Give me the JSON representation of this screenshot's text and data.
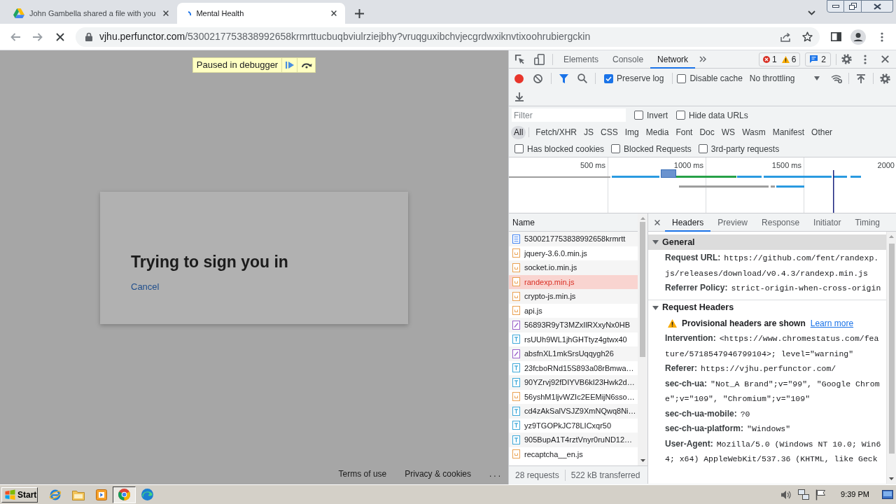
{
  "browser": {
    "tabs": [
      {
        "kind": "triangle",
        "title": "John Gambella shared a file with you",
        "selected": false
      },
      {
        "kind": "spinner",
        "title": "Mental Health",
        "selected": true
      }
    ],
    "address": {
      "host": "vjhu.perfunctor.com",
      "path": "/5300217753838992658krmrttucbuqbviulrziejbhy?vruqguxibchvjecgrdwxiknvtixoohrubiergckin"
    }
  },
  "page": {
    "debugger_banner": "Paused in debugger",
    "dialog": {
      "title": "Trying to sign you in",
      "cancel": "Cancel"
    },
    "footer_links": [
      "Terms of use",
      "Privacy & cookies",
      "..."
    ]
  },
  "devtools": {
    "tabs": [
      {
        "label": "Elements",
        "selected": false
      },
      {
        "label": "Console",
        "selected": false
      },
      {
        "label": "Network",
        "selected": true
      }
    ],
    "issues": {
      "errors": "1",
      "warnings": "6",
      "messages": "2"
    },
    "toolbar": {
      "checkboxes": [
        {
          "label": "Preserve log",
          "checked": true
        },
        {
          "label": "Disable cache",
          "checked": false
        }
      ],
      "throttling": "No throttling"
    },
    "filter": {
      "placeholder": "Filter",
      "options": [
        {
          "label": "Invert",
          "checked": false
        },
        {
          "label": "Hide data URLs",
          "checked": false
        }
      ]
    },
    "type_filters": [
      {
        "label": "All",
        "selected": true
      },
      {
        "label": "Fetch/XHR",
        "selected": false
      },
      {
        "label": "JS",
        "selected": false
      },
      {
        "label": "CSS",
        "selected": false
      },
      {
        "label": "Img",
        "selected": false
      },
      {
        "label": "Media",
        "selected": false
      },
      {
        "label": "Font",
        "selected": false
      },
      {
        "label": "Doc",
        "selected": false
      },
      {
        "label": "WS",
        "selected": false
      },
      {
        "label": "Wasm",
        "selected": false
      },
      {
        "label": "Manifest",
        "selected": false
      },
      {
        "label": "Other",
        "selected": false
      }
    ],
    "request_filters": [
      {
        "label": "Has blocked cookies",
        "checked": false
      },
      {
        "label": "Blocked Requests",
        "checked": false
      },
      {
        "label": "3rd-party requests",
        "checked": false
      }
    ],
    "overview": {
      "ticks": [
        "500 ms",
        "1000 ms",
        "1500 ms",
        "2000"
      ]
    },
    "requests": {
      "column": "Name",
      "rows": [
        {
          "name": "5300217753838992658krmrtt",
          "kind": "document",
          "selected": false,
          "failed": false
        },
        {
          "name": "jquery-3.6.0.min.js",
          "kind": "script",
          "selected": false,
          "failed": false
        },
        {
          "name": "socket.io.min.js",
          "kind": "script",
          "selected": false,
          "failed": false
        },
        {
          "name": "randexp.min.js",
          "kind": "script",
          "selected": true,
          "failed": true
        },
        {
          "name": "crypto-js.min.js",
          "kind": "script",
          "selected": false,
          "failed": false
        },
        {
          "name": "api.js",
          "kind": "script",
          "selected": false,
          "failed": false
        },
        {
          "name": "56893R9yT3MZxIlRXxyNx0HB",
          "kind": "other",
          "selected": false,
          "failed": false
        },
        {
          "name": "rsUUh9WL1jhGHTtyz4gtwx40",
          "kind": "text",
          "selected": false,
          "failed": false
        },
        {
          "name": "absfnXL1mkSrsUqqygh26",
          "kind": "other",
          "selected": false,
          "failed": false
        },
        {
          "name": "23fcboRNd15S893a08rBmwa…",
          "kind": "text",
          "selected": false,
          "failed": false
        },
        {
          "name": "90YZrvj92fDIYVB6kI23Hwk2d…",
          "kind": "text",
          "selected": false,
          "failed": false
        },
        {
          "name": "56yshM1ljvWZIc2EEMijN6sso…",
          "kind": "script",
          "selected": false,
          "failed": false
        },
        {
          "name": "cd4zAkSalVSJZ9XmNQwq8Ni…",
          "kind": "text",
          "selected": false,
          "failed": false
        },
        {
          "name": "yz9TGOPkJC78LICxqr50",
          "kind": "text",
          "selected": false,
          "failed": false
        },
        {
          "name": "905BupA1T4rztVnyr0ruND12…",
          "kind": "text",
          "selected": false,
          "failed": false
        },
        {
          "name": "recaptcha__en.js",
          "kind": "script",
          "selected": false,
          "failed": false
        }
      ]
    },
    "summary": [
      "28 requests",
      "522 kB transferred"
    ],
    "details": {
      "tabs": [
        {
          "label": "Headers",
          "selected": true
        },
        {
          "label": "Preview",
          "selected": false
        },
        {
          "label": "Response",
          "selected": false
        },
        {
          "label": "Initiator",
          "selected": false
        },
        {
          "label": "Timing",
          "selected": false
        }
      ],
      "sections": [
        {
          "title": "General",
          "expanded": true,
          "selected": true,
          "headers": [
            {
              "name": "Request URL:",
              "value": "https://github.com/fent/randexp.js/releases/download/v0.4.3/randexp.min.js"
            },
            {
              "name": "Referrer Policy:",
              "value": "strict-origin-when-cross-origin"
            }
          ]
        },
        {
          "title": "Request Headers",
          "expanded": true,
          "selected": false,
          "notice": {
            "text": "Provisional headers are shown",
            "link": "Learn more"
          },
          "headers": [
            {
              "name": "Intervention:",
              "value": "<https://www.chromestatus.com/feature/5718547946799104>; level=\"warning\""
            },
            {
              "name": "Referer:",
              "value": "https://vjhu.perfunctor.com/"
            },
            {
              "name": "sec-ch-ua:",
              "value": "\"Not_A Brand\";v=\"99\", \"Google Chrome\";v=\"109\", \"Chromium\";v=\"109\""
            },
            {
              "name": "sec-ch-ua-mobile:",
              "value": "?0"
            },
            {
              "name": "sec-ch-ua-platform:",
              "value": "\"Windows\""
            },
            {
              "name": "User-Agent:",
              "value": "Mozilla/5.0 (Windows NT 10.0; Win64; x64) AppleWebKit/537.36 (KHTML, like Geck"
            }
          ]
        }
      ]
    }
  },
  "taskbar": {
    "start": "Start",
    "apps": [
      {
        "kind": "globe",
        "active": false
      },
      {
        "kind": "folder",
        "active": false
      },
      {
        "kind": "player",
        "active": false
      },
      {
        "kind": "orb",
        "active": true
      },
      {
        "kind": "wave",
        "active": false
      }
    ],
    "clock": "9:39 PM"
  }
}
